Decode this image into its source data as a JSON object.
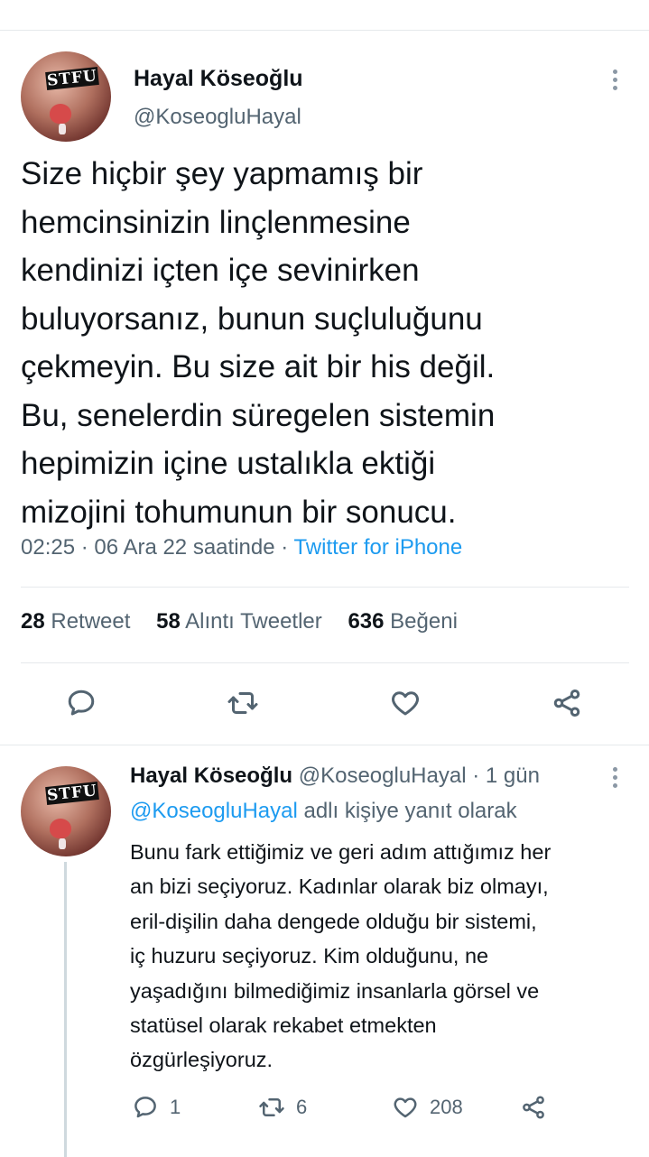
{
  "main_tweet": {
    "avatar_text": "STFU",
    "author_name": "Hayal Köseoğlu",
    "author_handle": "@KoseogluHayal",
    "lines": [
      "Size hiçbir şey yapmamış bir",
      "hemcinsinizin linçlenmesine",
      "kendinizi içten içe sevinirken",
      "buluyorsanız, bunun suçluluğunu",
      "çekmeyin. Bu size ait bir his değil.",
      "Bu, senelerdin süregelen sistemin",
      "hepimizin içine ustalıkla ektiği",
      "mizojini tohumunun bir sonucu."
    ],
    "time": "02:25",
    "date": "06 Ara 22 saatinde",
    "separator": "·",
    "source": "Twitter for iPhone",
    "stats": {
      "retweets_count": "28",
      "retweets_label": "Retweet",
      "quotes_count": "58",
      "quotes_label": "Alıntı Tweetler",
      "likes_count": "636",
      "likes_label": "Beğeni"
    }
  },
  "reply_tweet": {
    "avatar_text": "STFU",
    "author_name": "Hayal Köseoğlu",
    "author_handle": "@KoseogluHayal",
    "separator": "·",
    "age": "1 gün",
    "reply_to_mention": "@KoseogluHayal",
    "reply_to_suffix": "adlı kişiye yanıt olarak",
    "lines": [
      "Bunu fark ettiğimiz ve geri adım attığımız her",
      "an bizi seçiyoruz. Kadınlar olarak biz olmayı,",
      "eril-dişilin daha dengede olduğu bir sistemi,",
      "iç huzuru seçiyoruz. Kim olduğunu, ne",
      "yaşadığını bilmediğimiz insanlarla görsel ve",
      "statüsel olarak rekabet etmekten",
      "özgürleşiyoruz."
    ],
    "reply_count": "1",
    "retweet_count": "6",
    "like_count": "208"
  },
  "icons": {
    "reply": "speech-bubble-icon",
    "retweet": "retweet-arrows-icon",
    "like": "heart-icon",
    "share": "share-nodes-icon",
    "more": "vertical-dots-icon"
  },
  "colors": {
    "accent": "#1d9bf0",
    "text": "#0f1419",
    "secondary": "#536471",
    "divider": "#e6e9ec",
    "thread_line": "#cfd9de"
  }
}
